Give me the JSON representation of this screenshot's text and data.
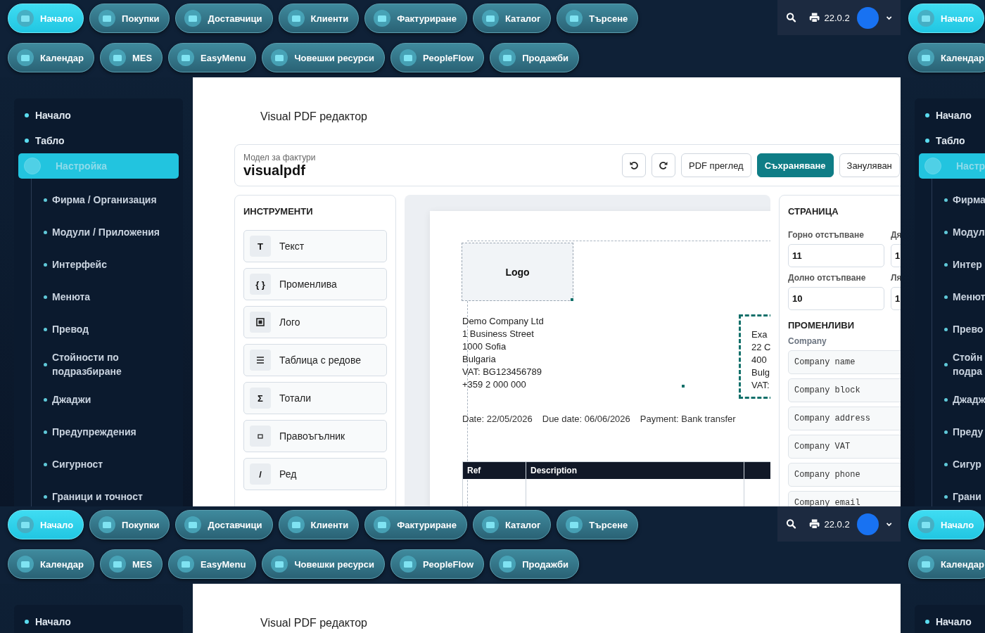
{
  "tiles": [
    {
      "nav_rows": [
        [
          {
            "label": "Начало",
            "selected": true
          },
          {
            "label": "Покупки",
            "selected": false
          },
          {
            "label": "Доставчици",
            "selected": false
          },
          {
            "label": "Клиенти",
            "selected": false
          },
          {
            "label": "Фактуриране",
            "selected": false
          },
          {
            "label": "Каталог",
            "selected": false
          },
          {
            "label": "Търсене",
            "selected": false
          }
        ],
        [
          {
            "label": "Календар",
            "selected": false
          },
          {
            "label": "MES",
            "selected": false
          },
          {
            "label": "EasyMenu",
            "selected": false
          },
          {
            "label": "Човешки ресурси",
            "selected": false
          },
          {
            "label": "PeopleFlow",
            "selected": false
          },
          {
            "label": "Продажби",
            "selected": false
          }
        ]
      ],
      "toolbar": {
        "version": "22.0.2"
      },
      "sidebar": [
        {
          "label": "Начало",
          "selected": false
        },
        {
          "label": "Табло",
          "selected": false
        },
        {
          "label": "Настройка",
          "selected": true,
          "children": [
            {
              "label": "Фирма / Организация"
            },
            {
              "label": "Модули / Приложения"
            },
            {
              "label": "Интерфейс"
            },
            {
              "label": "Менюта"
            },
            {
              "label": "Превод"
            },
            {
              "label": "Стойности по подразбиране"
            },
            {
              "label": "Джаджи"
            },
            {
              "label": "Предупреждения"
            },
            {
              "label": "Сигурност"
            },
            {
              "label": "Граници и точност"
            }
          ]
        }
      ],
      "page_title": "Visual PDF редактор",
      "editor": {
        "template_label": "Модел за фактури",
        "template_name": "visualpdf",
        "actions": [
          {
            "kind": "undo"
          },
          {
            "kind": "redo"
          },
          {
            "kind": "text",
            "label": "PDF преглед",
            "primary": false
          },
          {
            "kind": "text",
            "label": "Съхраняване",
            "primary": true
          },
          {
            "kind": "text",
            "label": "Зануляван",
            "primary": false
          }
        ],
        "tools_title": "ИНСТРУМЕНТИ",
        "tools": [
          {
            "kind": "glyph",
            "glyph": "T",
            "label": "Текст"
          },
          {
            "kind": "glyph",
            "glyph": "{ }",
            "label": "Променлива"
          },
          {
            "kind": "logo",
            "label": "Лого"
          },
          {
            "kind": "table",
            "label": "Таблица с редове"
          },
          {
            "kind": "glyph",
            "glyph": "Σ",
            "label": "Тотали"
          },
          {
            "kind": "rect",
            "label": "Правоъгълник"
          },
          {
            "kind": "glyph",
            "glyph": "/",
            "label": "Ред"
          }
        ],
        "canvas": {
          "logo": "Logo",
          "company_lines": [
            "Demo Company Ltd",
            "1 Business Street",
            "1000 Sofia",
            "Bulgaria",
            "VAT: BG123456789",
            "+359 2 000 000"
          ],
          "client_lines": [
            "Exa",
            "22 C",
            "400",
            "Bulg",
            "VAT:"
          ],
          "meta": [
            "Date: 22/05/2026",
            "Due date: 06/06/2026",
            "Payment: Bank transfer"
          ],
          "table_columns": [
            "Ref",
            "Description"
          ]
        },
        "page_settings": {
          "title": "СТРАНИЦА",
          "fields": [
            {
              "label": "Горно отстъпване",
              "value": "11"
            },
            {
              "label": "Дя",
              "value": "1"
            },
            {
              "label": "Долно отстъпване",
              "value": "10"
            },
            {
              "label": "Ля",
              "value": "1"
            }
          ]
        },
        "variables": {
          "title": "ПРОМЕНЛИВИ",
          "group": "Company",
          "items": [
            "Company name",
            "Company block",
            "Company address",
            "Company VAT",
            "Company phone",
            "Company email"
          ]
        }
      }
    },
    {
      "nav_rows": [
        [
          {
            "label": "Начало",
            "selected": true
          }
        ],
        [
          {
            "label": "Календар",
            "selected": false
          }
        ]
      ],
      "sidebar": [
        {
          "label": "Начало",
          "selected": false
        },
        {
          "label": "Табло",
          "selected": false
        },
        {
          "label": "Настр",
          "selected": true,
          "children": [
            {
              "label": "Фирма"
            },
            {
              "label": "Модул"
            },
            {
              "label": "Интер"
            },
            {
              "label": "Менют"
            },
            {
              "label": "Прево"
            },
            {
              "label": "Стойн\nподра"
            },
            {
              "label": "Джадж"
            },
            {
              "label": "Преду"
            },
            {
              "label": "Сигур"
            },
            {
              "label": "Грани"
            }
          ]
        }
      ]
    },
    {
      "nav_rows": [
        [
          {
            "label": "Начало",
            "selected": true
          },
          {
            "label": "Покупки",
            "selected": false
          },
          {
            "label": "Доставчици",
            "selected": false
          },
          {
            "label": "Клиенти",
            "selected": false
          },
          {
            "label": "Фактуриране",
            "selected": false
          },
          {
            "label": "Каталог",
            "selected": false
          },
          {
            "label": "Търсене",
            "selected": false
          }
        ],
        [
          {
            "label": "Календар",
            "selected": false
          },
          {
            "label": "MES",
            "selected": false
          },
          {
            "label": "EasyMenu",
            "selected": false
          },
          {
            "label": "Човешки ресурси",
            "selected": false
          },
          {
            "label": "PeopleFlow",
            "selected": false
          },
          {
            "label": "Продажби",
            "selected": false
          }
        ]
      ],
      "toolbar": {
        "version": "22.0.2"
      },
      "sidebar": [
        {
          "label": "Начало",
          "selected": false
        }
      ],
      "page_title": "Visual PDF редактор"
    },
    {
      "nav_rows": [
        [
          {
            "label": "Начало",
            "selected": true
          }
        ],
        [
          {
            "label": "Календар",
            "selected": false
          }
        ]
      ],
      "sidebar": [
        {
          "label": "Начало",
          "selected": false
        }
      ]
    }
  ]
}
